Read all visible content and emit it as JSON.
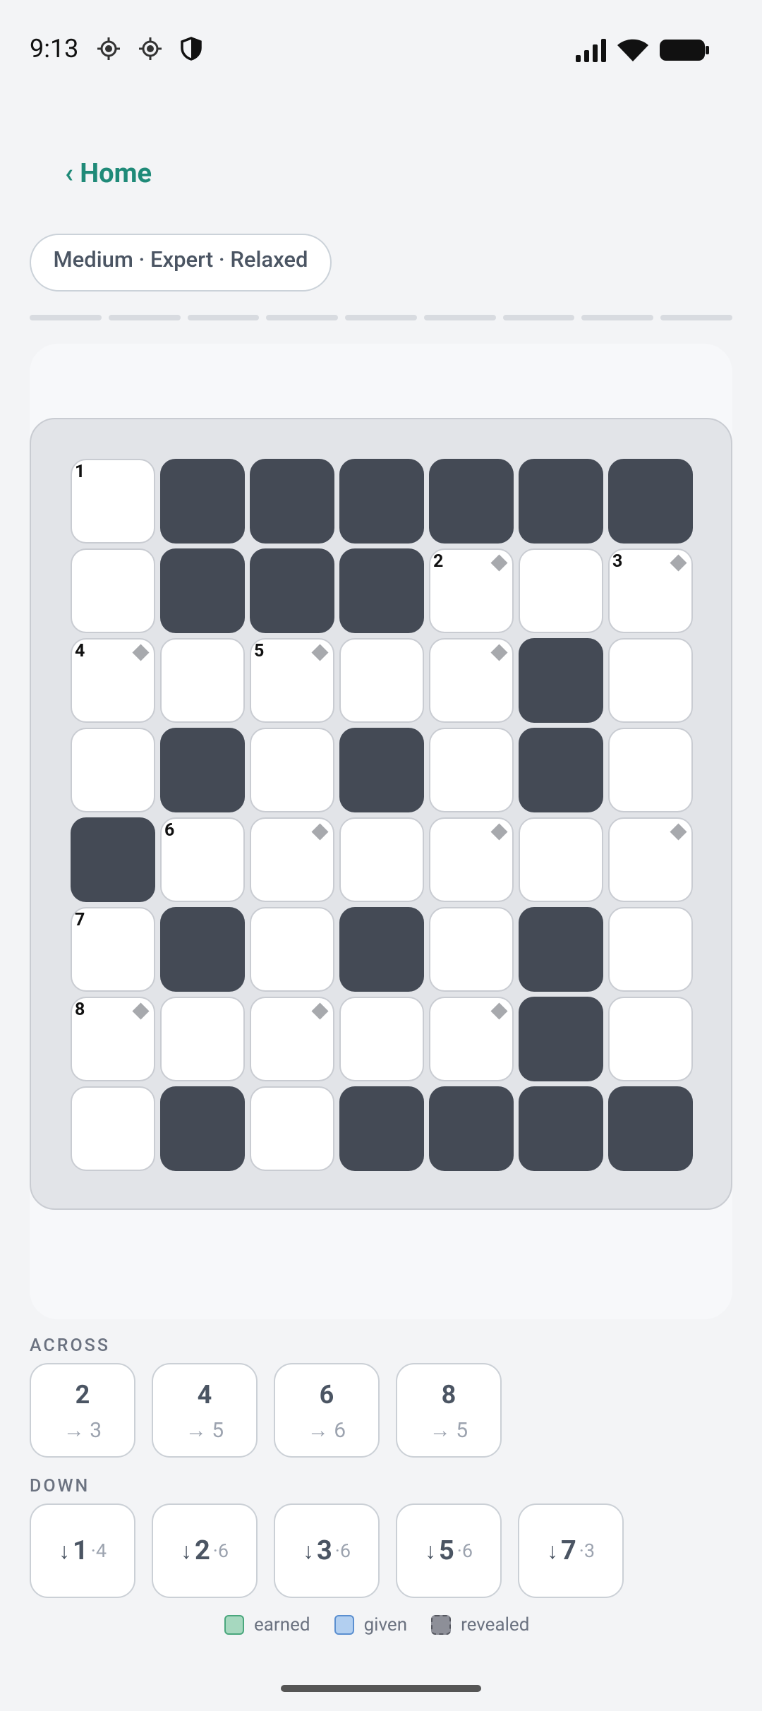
{
  "status_bar": {
    "time": "9:13",
    "left_icons": [
      "gps-icon",
      "gps-icon",
      "vpn-shield-icon"
    ],
    "right_icons": [
      "signal-icon",
      "wifi-icon",
      "battery-icon"
    ]
  },
  "nav": {
    "home_label": "‹ Home"
  },
  "mode_pill": {
    "label": "Medium · Expert · Relaxed"
  },
  "progress": {
    "segments": 9,
    "completed": 0
  },
  "grid": {
    "rows": 8,
    "cols": 7,
    "layout": [
      "W######",
      "W###WWW",
      "WWWWW#W",
      "W#W#W#W",
      "#WWWWWW",
      "W#W#W#W",
      "WWWWW#W",
      "W#W####"
    ],
    "numbers": [
      {
        "r": 0,
        "c": 0,
        "n": "1"
      },
      {
        "r": 1,
        "c": 4,
        "n": "2"
      },
      {
        "r": 1,
        "c": 6,
        "n": "3"
      },
      {
        "r": 2,
        "c": 0,
        "n": "4"
      },
      {
        "r": 2,
        "c": 2,
        "n": "5"
      },
      {
        "r": 4,
        "c": 1,
        "n": "6"
      },
      {
        "r": 5,
        "c": 0,
        "n": "7"
      },
      {
        "r": 6,
        "c": 0,
        "n": "8"
      }
    ],
    "markers": [
      {
        "r": 1,
        "c": 4
      },
      {
        "r": 1,
        "c": 6
      },
      {
        "r": 2,
        "c": 0
      },
      {
        "r": 2,
        "c": 2
      },
      {
        "r": 2,
        "c": 4
      },
      {
        "r": 4,
        "c": 2
      },
      {
        "r": 4,
        "c": 4
      },
      {
        "r": 4,
        "c": 6
      },
      {
        "r": 6,
        "c": 0
      },
      {
        "r": 6,
        "c": 2
      },
      {
        "r": 6,
        "c": 4
      }
    ],
    "colors": {
      "white": "#ffffff",
      "black": "#444a55",
      "marker": "#a7a9ad"
    }
  },
  "across": {
    "label": "ACROSS",
    "clues": [
      {
        "num": "2",
        "len": "→ 3"
      },
      {
        "num": "4",
        "len": "→ 5"
      },
      {
        "num": "6",
        "len": "→ 6"
      },
      {
        "num": "8",
        "len": "→ 5"
      }
    ]
  },
  "down": {
    "label": "DOWN",
    "clues": [
      {
        "arrow": "↓",
        "num": "1",
        "len": "·4"
      },
      {
        "arrow": "↓",
        "num": "2",
        "len": "·6"
      },
      {
        "arrow": "↓",
        "num": "3",
        "len": "·6"
      },
      {
        "arrow": "↓",
        "num": "5",
        "len": "·6"
      },
      {
        "arrow": "↓",
        "num": "7",
        "len": "·3"
      }
    ]
  },
  "legend": {
    "earned": "earned",
    "given": "given",
    "revealed": "revealed"
  },
  "accent_color": "#1f8a78"
}
